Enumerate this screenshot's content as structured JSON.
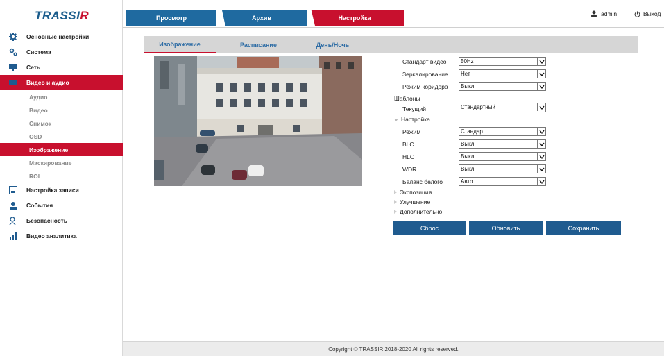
{
  "brand": {
    "logo_main": "TRASSI",
    "logo_r": "R"
  },
  "sidebar": {
    "items": [
      {
        "label": "Основные настройки",
        "icon": "gear-icon"
      },
      {
        "label": "Система",
        "icon": "gears-icon"
      },
      {
        "label": "Сеть",
        "icon": "network-icon"
      },
      {
        "label": "Видео и аудио",
        "icon": "video-icon"
      },
      {
        "label": "Настройка записи",
        "icon": "record-icon"
      },
      {
        "label": "События",
        "icon": "event-icon"
      },
      {
        "label": "Безопасность",
        "icon": "security-icon"
      },
      {
        "label": "Видео аналитика",
        "icon": "analytics-icon"
      }
    ],
    "subitems": [
      "Аудио",
      "Видео",
      "Снимок",
      "OSD",
      "Изображение",
      "Маскирование",
      "ROI"
    ]
  },
  "top": {
    "tabs": [
      "Просмотр",
      "Архив",
      "Настройка"
    ],
    "user": "admin",
    "logout": "Выход"
  },
  "subtabs": [
    "Изображение",
    "Расписание",
    "День/Ночь"
  ],
  "form": {
    "video_standard_label": "Стандарт видео",
    "video_standard": "50Hz",
    "mirror_label": "Зеркалирование",
    "mirror": "Нет",
    "corridor_label": "Режим коридора",
    "corridor": "Выкл.",
    "templates_label": "Шаблоны",
    "current_label": "Текущий",
    "current": "Стандартный",
    "setup_label": "Настройка",
    "mode_label": "Режим",
    "mode": "Стандарт",
    "blc_label": "BLC",
    "blc": "Выкл.",
    "hlc_label": "HLC",
    "hlc": "Выкл.",
    "wdr_label": "WDR",
    "wdr": "Выкл.",
    "wb_label": "Баланс белого",
    "wb": "Авто",
    "exposure_label": "Экспозиция",
    "enhance_label": "Улучшение",
    "extra_label": "Дополнительно"
  },
  "buttons": {
    "reset": "Сброс",
    "refresh": "Обновить",
    "save": "Сохранить"
  },
  "footer": "Copyright © TRASSIR 2018-2020 All rights reserved.",
  "colors": {
    "accent": "#c8102e",
    "blue": "#1f6aa0",
    "button": "#1f5b8f"
  }
}
